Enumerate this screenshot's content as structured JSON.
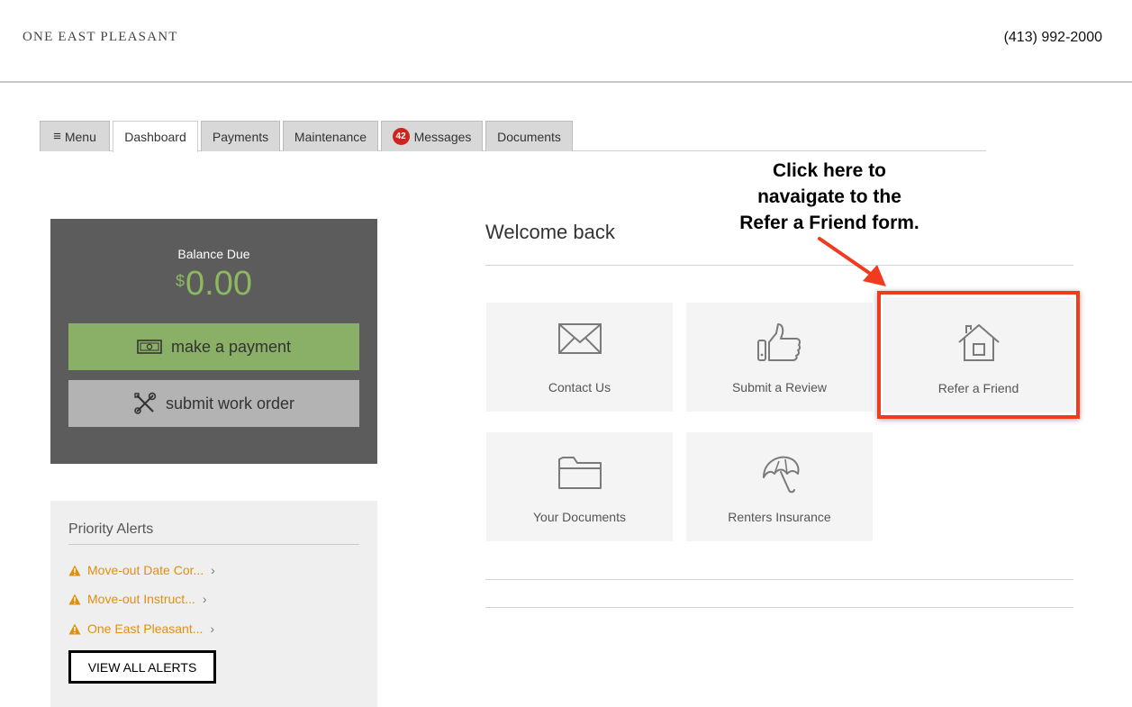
{
  "header": {
    "logo_text": "ONE EAST PLEASANT",
    "phone": "(413) 992-2000"
  },
  "tabs": [
    {
      "label": "Menu"
    },
    {
      "label": "Dashboard"
    },
    {
      "label": "Payments"
    },
    {
      "label": "Maintenance"
    },
    {
      "label": "Messages",
      "badge": "42"
    },
    {
      "label": "Documents"
    }
  ],
  "active_tab": "Dashboard",
  "balance": {
    "label": "Balance Due",
    "currency": "$",
    "amount": "0.00",
    "pay_button": "make a payment",
    "work_order_button": "submit work order"
  },
  "alerts": {
    "title": "Priority Alerts",
    "items": [
      "Move-out Date Cor...",
      "Move-out Instruct...",
      "One East Pleasant..."
    ],
    "view_all": "VIEW ALL ALERTS"
  },
  "welcome": {
    "title": "Welcome back"
  },
  "tiles": [
    {
      "label": "Contact Us",
      "icon": "envelope-icon"
    },
    {
      "label": "Submit a Review",
      "icon": "thumbs-up-icon"
    },
    {
      "label": "Refer a Friend",
      "icon": "house-icon"
    },
    {
      "label": "Your Documents",
      "icon": "folder-icon"
    },
    {
      "label": "Renters Insurance",
      "icon": "umbrella-icon"
    }
  ],
  "annotation": {
    "lines": [
      "Click here to",
      "navaigate to the",
      "Refer a Friend form."
    ]
  },
  "colors": {
    "balance_bg": "#5c5c5c",
    "amount_green": "#8cb85f",
    "pay_button": "#8aaf66",
    "work_button": "#b3b3b3",
    "alert_orange": "#e08f0f",
    "badge_red": "#d0231d",
    "highlight_red": "#f23a1e"
  }
}
